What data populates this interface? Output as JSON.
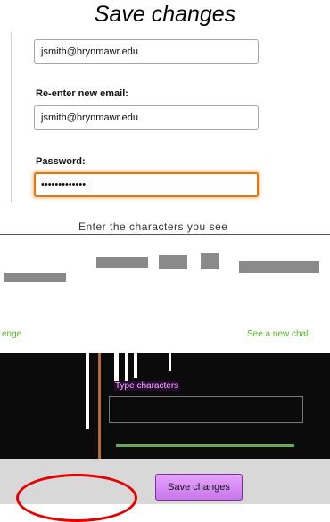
{
  "caption": "Save changes",
  "form": {
    "new_email_value": "jsmith@brynmawr.edu",
    "reenter_label": "Re-enter new email:",
    "reenter_value": "jsmith@brynmawr.edu",
    "password_label": "Password:",
    "password_value": "•••••••••••••"
  },
  "captcha": {
    "prompt": "Enter the characters you see",
    "link_left": "enge",
    "link_right": "See a new chall",
    "type_label": "Type characters",
    "type_value": ""
  },
  "footer": {
    "save_label": "Save changes"
  },
  "colors": {
    "focus_border": "#e77600",
    "link": "#55b52a",
    "button": "#c776ea",
    "annotation": "#e50000"
  }
}
